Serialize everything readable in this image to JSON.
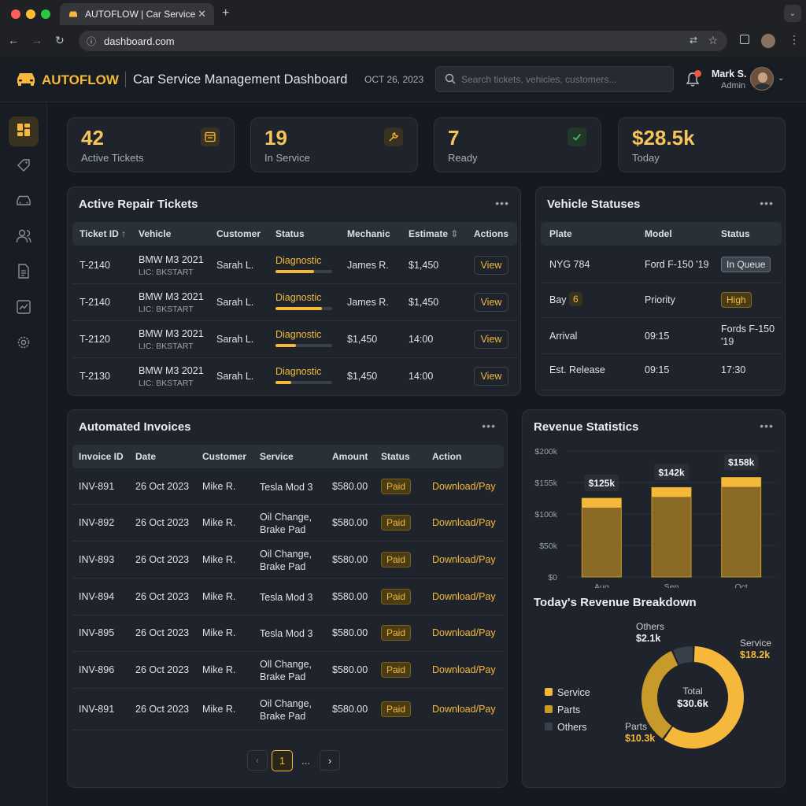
{
  "browser": {
    "tab_title": "AUTOFLOW | Car Service Man",
    "url": "dashboard.com"
  },
  "header": {
    "brand": "AUTOFLOW",
    "title": "Car Service Management Dashboard",
    "date": "OCT 26, 2023",
    "search_placeholder": "Search tickets, vehicles, customers...",
    "user_name": "Mark S.",
    "user_role": "Admin"
  },
  "stats": [
    {
      "value": "42",
      "label": "Active Tickets",
      "icon": "ticket-icon"
    },
    {
      "value": "19",
      "label": "In Service",
      "icon": "wrench-icon"
    },
    {
      "value": "7",
      "label": "Ready",
      "icon": "check-icon"
    },
    {
      "value": "$28.5k",
      "label": "Today",
      "icon": ""
    }
  ],
  "tickets": {
    "title": "Active Repair Tickets",
    "columns": [
      "Ticket ID",
      "Vehicle",
      "Customer",
      "Status",
      "Mechanic",
      "Estimate",
      "Actions"
    ],
    "rows": [
      {
        "id": "T-2140",
        "vehicle": "BMW M3 2021",
        "plate": "LIC: BKSTART",
        "customer": "Sarah L.",
        "status": "Diagnostic",
        "progress": 0.68,
        "c5": "James R.",
        "c6": "$1,450",
        "action": "View"
      },
      {
        "id": "T-2140",
        "vehicle": "BMW M3 2021",
        "plate": "LIC: BKSTART",
        "customer": "Sarah L.",
        "status": "Diagnostic",
        "progress": 0.82,
        "c5": "James R.",
        "c6": "$1,450",
        "action": "View"
      },
      {
        "id": "T-2120",
        "vehicle": "BMW M3 2021",
        "plate": "LIC: BKSTART",
        "customer": "Sarah L.",
        "status": "Diagnostic",
        "progress": 0.36,
        "c5": "$1,450",
        "c6": "14:00",
        "action": "View"
      },
      {
        "id": "T-2130",
        "vehicle": "BMW M3 2021",
        "plate": "LIC: BKSTART",
        "customer": "Sarah L.",
        "status": "Diagnostic",
        "progress": 0.28,
        "c5": "$1,450",
        "c6": "14:00",
        "action": "View"
      }
    ]
  },
  "vehicles": {
    "title": "Vehicle Statuses",
    "columns": [
      "Plate",
      "Model",
      "Status"
    ],
    "rows": [
      {
        "a": "NYG 784",
        "b": "Ford F-150 '19",
        "c": "In Queue"
      },
      {
        "a": "Bay",
        "a_badge": "6",
        "b": "Priority",
        "c": "High"
      },
      {
        "a": "Arrival",
        "b": "09:15",
        "c": "Fords F-150 '19"
      },
      {
        "a": "Est. Release",
        "b": "09:15",
        "c": "17:30"
      }
    ]
  },
  "invoices": {
    "title": "Automated Invoices",
    "columns": [
      "Invoice ID",
      "Date",
      "Customer",
      "Service",
      "Amount",
      "Status",
      "Action"
    ],
    "rows": [
      {
        "id": "INV-891",
        "date": "26 Oct 2023",
        "customer": "Mike R.",
        "service": "Tesla Mod 3",
        "amount": "$580.00",
        "status": "Paid",
        "action": "Download/Pay"
      },
      {
        "id": "INV-892",
        "date": "26 Oct 2023",
        "customer": "Mike R.",
        "service": "Oil Change, Brake Pad",
        "amount": "$580.00",
        "status": "Paid",
        "action": "Download/Pay"
      },
      {
        "id": "INV-893",
        "date": "26 Oct 2023",
        "customer": "Mike R.",
        "service": "Oil Change, Brake Pad",
        "amount": "$580.00",
        "status": "Paid",
        "action": "Download/Pay"
      },
      {
        "id": "INV-894",
        "date": "26 Oct 2023",
        "customer": "Mike R.",
        "service": "Tesla Mod 3",
        "amount": "$580.00",
        "status": "Paid",
        "action": "Download/Pay"
      },
      {
        "id": "INV-895",
        "date": "26 Oct 2023",
        "customer": "Mike R.",
        "service": "Tesla Mod 3",
        "amount": "$580.00",
        "status": "Paid",
        "action": "Download/Pay"
      },
      {
        "id": "INV-896",
        "date": "26 Oct 2023",
        "customer": "Mike R.",
        "service": "Oll Change, Brake Pad",
        "amount": "$580.00",
        "status": "Paid",
        "action": "Download/Pay"
      },
      {
        "id": "INV-891",
        "date": "26 Oct 2023",
        "customer": "Mike R.",
        "service": "Oil Change, Brake Pad",
        "amount": "$580.00",
        "status": "Paid",
        "action": "Download/Pay"
      }
    ],
    "pagination": {
      "current": "1",
      "ellipsis": "..."
    }
  },
  "revenue": {
    "title": "Revenue Statistics",
    "breakdown_title": "Today's Revenue Breakdown"
  },
  "chart_data": [
    {
      "type": "bar",
      "title": "Revenue Statistics",
      "categories": [
        "Aug",
        "Sep",
        "Oct"
      ],
      "values": [
        125,
        142,
        158
      ],
      "value_labels": [
        "$125k",
        "$142k",
        "$158k"
      ],
      "ylim": [
        0,
        200
      ],
      "yticks": [
        "$0",
        "$50k",
        "$100k",
        "$155k",
        "$200k"
      ],
      "ytick_values": [
        0,
        50,
        100,
        150,
        200
      ],
      "color": "#f5b83a"
    },
    {
      "type": "pie",
      "title": "Today's Revenue Breakdown",
      "center_label": "Total",
      "center_value": "$30.6k",
      "slices": [
        {
          "name": "Service",
          "label": "$18.2k",
          "value": 18.2,
          "color": "#f5b83a"
        },
        {
          "name": "Parts",
          "label": "$10.3k",
          "value": 10.3,
          "color": "#c89a2a"
        },
        {
          "name": "Others",
          "label": "$2.1k",
          "value": 2.1,
          "color": "#3a404a"
        }
      ]
    }
  ]
}
